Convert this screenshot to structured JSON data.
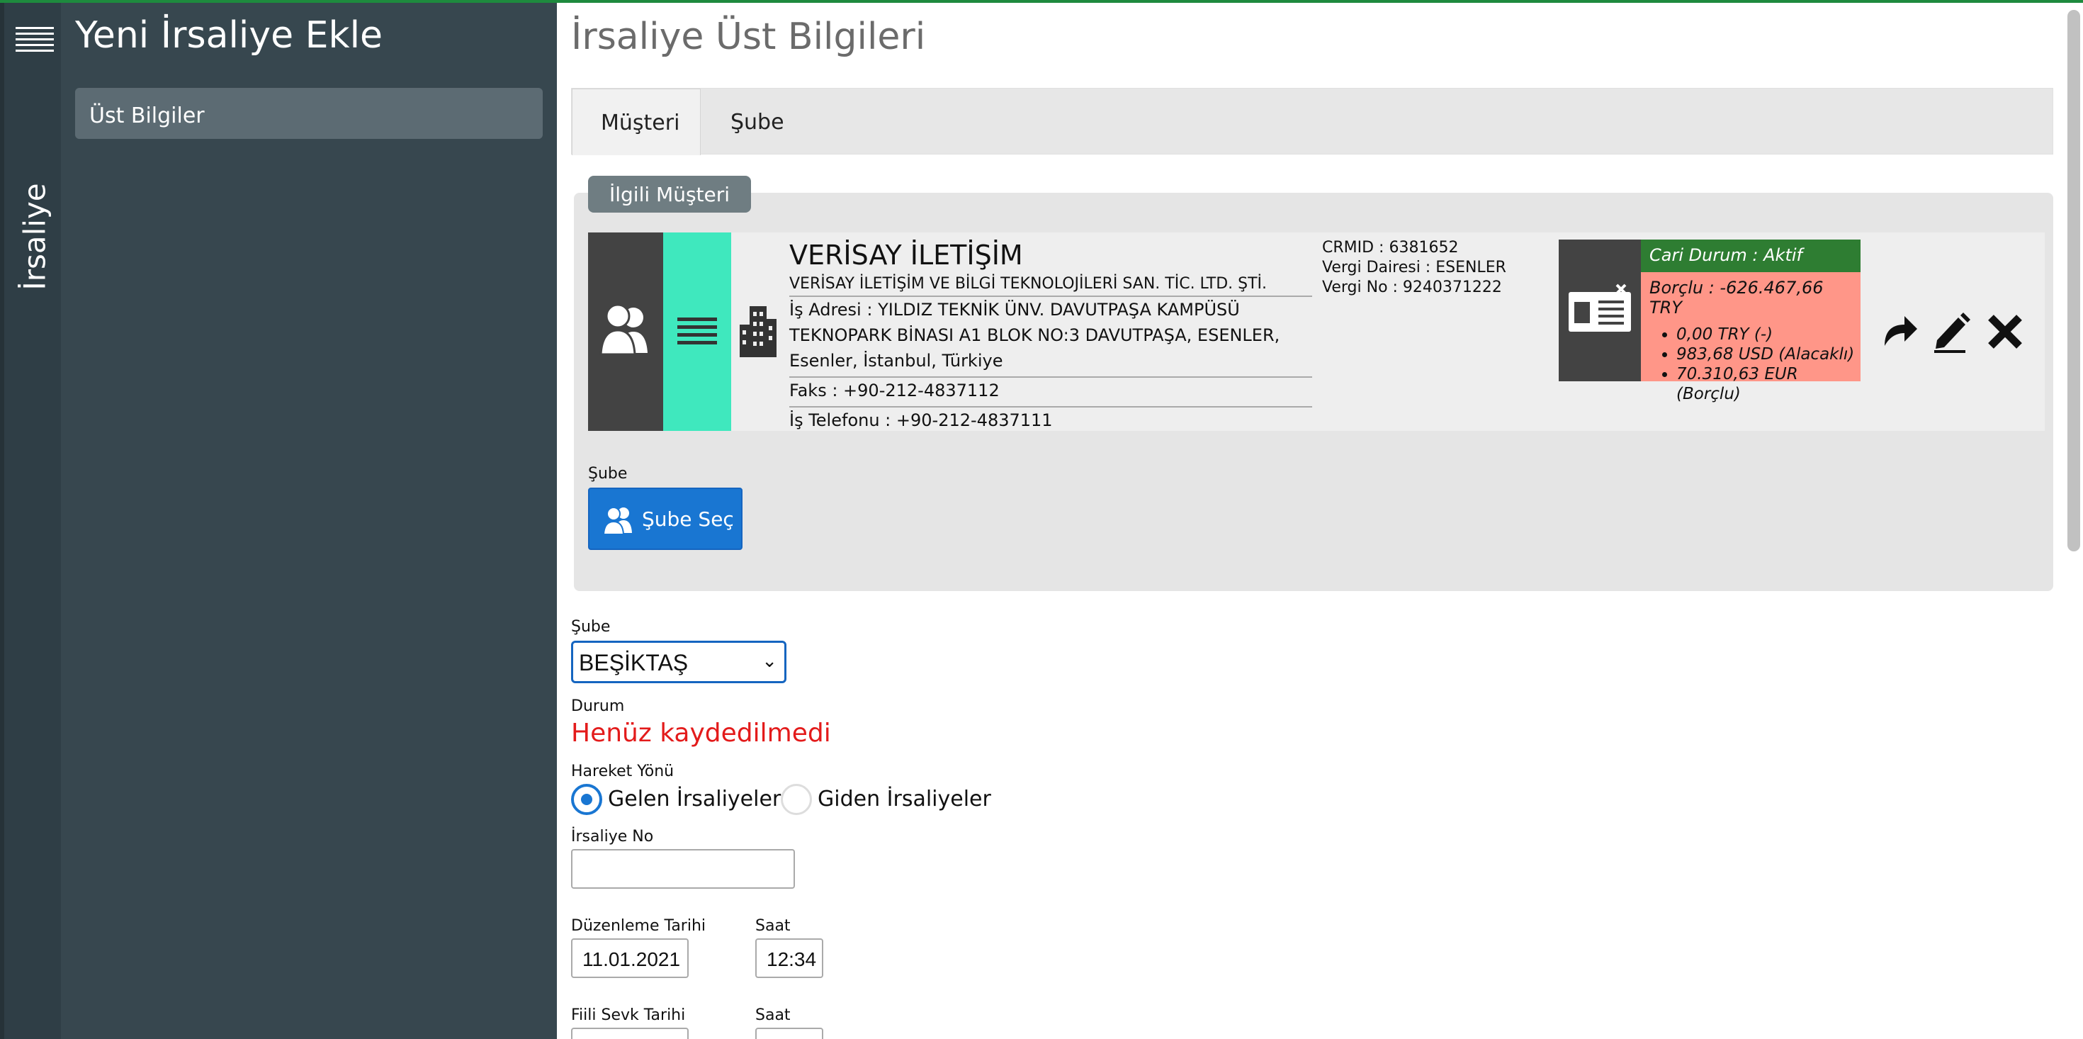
{
  "rail": {
    "label": "İrsaliye"
  },
  "sidebar": {
    "title": "Yeni İrsaliye Ekle",
    "items": [
      {
        "label": "Üst Bilgiler"
      }
    ]
  },
  "main": {
    "title": "İrsaliye Üst Bilgileri",
    "tabs": [
      {
        "label": "Müşteri"
      },
      {
        "label": "Şube"
      }
    ],
    "panel": {
      "badge": "İlgili Müşteri",
      "customer": {
        "name": "VERİSAY İLETİŞİM",
        "full_name": "VERİSAY İLETİŞİM VE BİLGİ TEKNOLOJİLERİ SAN. TİC. LTD. ŞTİ.",
        "address": "İş Adresi : YILDIZ TEKNİK ÜNV. DAVUTPAŞA KAMPÜSÜ TEKNOPARK BİNASI A1 BLOK NO:3 DAVUTPAŞA, ESENLER, Esenler, İstanbul, Türkiye",
        "fax": "Faks : +90-212-4837112",
        "phone": "İş Telefonu : +90-212-4837111",
        "crmid": "CRMID : 6381652",
        "tax_office": "Vergi Dairesi : ESENLER",
        "tax_no": "Vergi No : 9240371222"
      },
      "cari": {
        "status": "Cari Durum : Aktif",
        "balance": "Borçlu : -626.467,66 TRY",
        "items": [
          "0,00 TRY (-)",
          "983,68 USD (Alacaklı)",
          "70.310,63 EUR (Borçlu)"
        ]
      },
      "sube_label": "Şube",
      "sube_button": "Şube Seç"
    },
    "form": {
      "sube_label": "Şube",
      "sube_value": "BEŞİKTAŞ",
      "durum_label": "Durum",
      "durum_value": "Henüz kaydedilmedi",
      "hareket_label": "Hareket Yönü",
      "radio_in": "Gelen İrsaliyeler",
      "radio_out": "Giden İrsaliyeler",
      "irsaliye_no_label": "İrsaliye No",
      "duzenleme_label": "Düzenleme Tarihi",
      "duzenleme_value": "11.01.2021",
      "saat_label": "Saat",
      "saat_value": "12:34",
      "sevk_label": "Fiili Sevk Tarihi",
      "saat2_label": "Saat"
    }
  },
  "colors": {
    "accent": "#1976d2",
    "sidebar": "#37474f",
    "status_red": "#e31b1b",
    "cari_green": "#2e7d32",
    "cari_red": "#ff9688"
  }
}
